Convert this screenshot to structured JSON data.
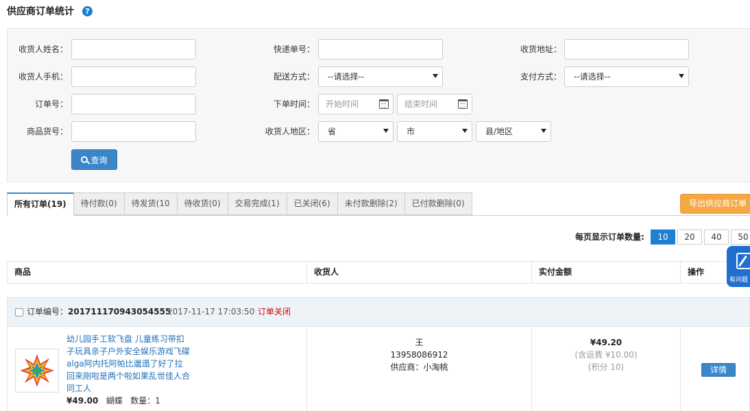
{
  "page": {
    "title": "供应商订单统计",
    "help_icon": "?"
  },
  "filters": {
    "receiver_name_label": "收货人姓名：",
    "tracking_no_label": "快递单号：",
    "address_label": "收货地址：",
    "receiver_phone_label": "收货人手机：",
    "delivery_label": "配送方式：",
    "delivery_value": "--请选择--",
    "payment_label": "支付方式：",
    "payment_value": "--请选择--",
    "order_no_label": "订单号：",
    "order_time_label": "下单时间：",
    "start_time_placeholder": "开始时间",
    "end_time_placeholder": "结束时间",
    "sku_label": "商品货号：",
    "region_label": "收货人地区：",
    "province_value": "省",
    "city_value": "市",
    "county_value": "县/地区",
    "search_label": "查询"
  },
  "tabs": [
    {
      "label": "所有订单(19)"
    },
    {
      "label": "待付款(0)"
    },
    {
      "label": "待发货(10"
    },
    {
      "label": "待收货(0)"
    },
    {
      "label": "交易完成(1)"
    },
    {
      "label": "已关闭(6)"
    },
    {
      "label": "未付款删除(2)"
    },
    {
      "label": "已付款删除(0)"
    }
  ],
  "export_label": "导出供应商订单",
  "per_page": {
    "label": "每页显示订单数量:",
    "options": [
      "10",
      "20",
      "40",
      "50"
    ],
    "selected": "10"
  },
  "table": {
    "headers": {
      "product": "商品",
      "receiver": "收货人",
      "amount": "实付金额",
      "actions": "操作"
    }
  },
  "order": {
    "no_label": "订单编号：",
    "no": "201711170943054555",
    "time": "2017-11-17 17:03:50",
    "status": "订单关闭",
    "product_name": "幼儿园手工软飞盘 儿童练习带扣子玩具亲子户外安全娱乐游戏飞碟alga阿内托阿帕比邋遢了好了拉回来刚啦是两个啦如果乱世佳人合同工人",
    "price": "¥49.00",
    "spec": "蝴蝶",
    "qty_label": "数量：1",
    "receiver_name": "王",
    "receiver_phone": "13958086912",
    "supplier": "供应商：小淘桃",
    "amount": "¥49.20",
    "shipping": "(含运费 ¥10.00)",
    "points": "(积分 10)",
    "detail_label": "详情"
  },
  "float_widget": {
    "text": "有问题 上"
  },
  "colors": {
    "primary": "#3a86c8",
    "export": "#f5a742",
    "status_closed": "#d40000",
    "link": "#1f6fb8"
  }
}
